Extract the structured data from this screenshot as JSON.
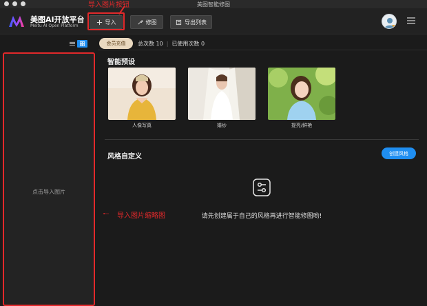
{
  "window": {
    "title": "美图智能修图"
  },
  "brand": {
    "name": "美图AI开放平台",
    "subtitle": "Meitu AI Open Platform",
    "colors": {
      "accent": "#1f8ef1",
      "annotation": "#e3292b",
      "vip": "#ead9c0"
    }
  },
  "toolbar": {
    "import_label": "导入",
    "import_icon": "plus-icon",
    "retouch_label": "修图",
    "retouch_icon": "brush-icon",
    "export_label": "导出列表",
    "export_icon": "export-list-icon"
  },
  "annotations": {
    "import_button": "导入图片按钮",
    "thumbnail_panel": "导入图片缩略图"
  },
  "sidebar": {
    "placeholder": "点击导入图片",
    "view_modes": [
      "list",
      "grid"
    ],
    "active_view": "grid"
  },
  "account": {
    "vip_label": "会员充值",
    "total_label": "总次数 10",
    "used_label": "已使用次数 0"
  },
  "presets": {
    "title": "智能预设",
    "items": [
      {
        "label": "人像写真"
      },
      {
        "label": "婚纱"
      },
      {
        "label": "提亮/鲜艳"
      }
    ]
  },
  "custom_styles": {
    "title": "风格自定义",
    "create_label": "创建风格",
    "empty_text": "请先创建属于自己的风格再进行智能修图哟!"
  }
}
